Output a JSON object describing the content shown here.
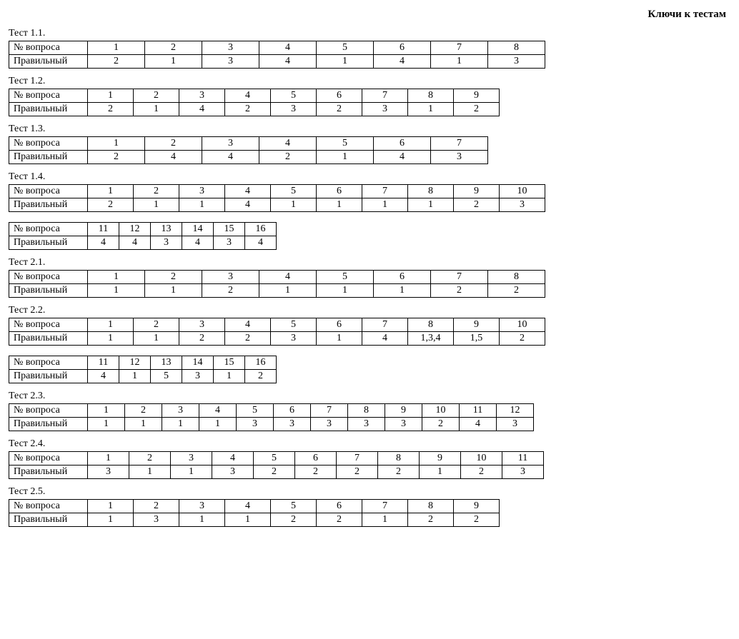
{
  "title": "Ключи к тестам",
  "labels": {
    "question": "№ вопроса",
    "correct": "Правильный"
  },
  "tests": [
    {
      "name": "Тест 1.1.",
      "cellWidth": 80,
      "questions": [
        "1",
        "2",
        "3",
        "4",
        "5",
        "6",
        "7",
        "8"
      ],
      "answers": [
        "2",
        "1",
        "3",
        "4",
        "1",
        "4",
        "1",
        "3"
      ]
    },
    {
      "name": "Тест 1.2.",
      "cellWidth": 64,
      "questions": [
        "1",
        "2",
        "3",
        "4",
        "5",
        "6",
        "7",
        "8",
        "9"
      ],
      "answers": [
        "2",
        "1",
        "4",
        "2",
        "3",
        "2",
        "3",
        "1",
        "2"
      ]
    },
    {
      "name": "Тест 1.3.",
      "cellWidth": 80,
      "questions": [
        "1",
        "2",
        "3",
        "4",
        "5",
        "6",
        "7"
      ],
      "answers": [
        "2",
        "4",
        "4",
        "2",
        "1",
        "4",
        "3"
      ]
    },
    {
      "name": "Тест 1.4.",
      "cellWidth": 64,
      "questions": [
        "1",
        "2",
        "3",
        "4",
        "5",
        "6",
        "7",
        "8",
        "9",
        "10"
      ],
      "answers": [
        "2",
        "1",
        "1",
        "4",
        "1",
        "1",
        "1",
        "1",
        "2",
        "3"
      ],
      "continuation": {
        "cellWidth": 44,
        "questions": [
          "11",
          "12",
          "13",
          "14",
          "15",
          "16"
        ],
        "answers": [
          "4",
          "4",
          "3",
          "4",
          "3",
          "4"
        ]
      }
    },
    {
      "name": "Тест 2.1.",
      "cellWidth": 80,
      "questions": [
        "1",
        "2",
        "3",
        "4",
        "5",
        "6",
        "7",
        "8"
      ],
      "answers": [
        "1",
        "1",
        "2",
        "1",
        "1",
        "1",
        "2",
        "2"
      ]
    },
    {
      "name": "Тест 2.2.",
      "cellWidth": 64,
      "questions": [
        "1",
        "2",
        "3",
        "4",
        "5",
        "6",
        "7",
        "8",
        "9",
        "10"
      ],
      "answers": [
        "1",
        "1",
        "2",
        "2",
        "3",
        "1",
        "4",
        "1,3,4",
        "1,5",
        "2"
      ],
      "continuation": {
        "cellWidth": 44,
        "questions": [
          "11",
          "12",
          "13",
          "14",
          "15",
          "16"
        ],
        "answers": [
          "4",
          "1",
          "5",
          "3",
          "1",
          "2"
        ]
      }
    },
    {
      "name": "Тест 2.3.",
      "cellWidth": 52,
      "questions": [
        "1",
        "2",
        "3",
        "4",
        "5",
        "6",
        "7",
        "8",
        "9",
        "10",
        "11",
        "12"
      ],
      "answers": [
        "1",
        "1",
        "1",
        "1",
        "3",
        "3",
        "3",
        "3",
        "3",
        "2",
        "4",
        "3"
      ]
    },
    {
      "name": "Тест 2.4.",
      "cellWidth": 58,
      "questions": [
        "1",
        "2",
        "3",
        "4",
        "5",
        "6",
        "7",
        "8",
        "9",
        "10",
        "11"
      ],
      "answers": [
        "3",
        "1",
        "1",
        "3",
        "2",
        "2",
        "2",
        "2",
        "1",
        "2",
        "3"
      ]
    },
    {
      "name": "Тест 2.5.",
      "cellWidth": 64,
      "questions": [
        "1",
        "2",
        "3",
        "4",
        "5",
        "6",
        "7",
        "8",
        "9"
      ],
      "answers": [
        "1",
        "3",
        "1",
        "1",
        "2",
        "2",
        "1",
        "2",
        "2"
      ]
    }
  ]
}
